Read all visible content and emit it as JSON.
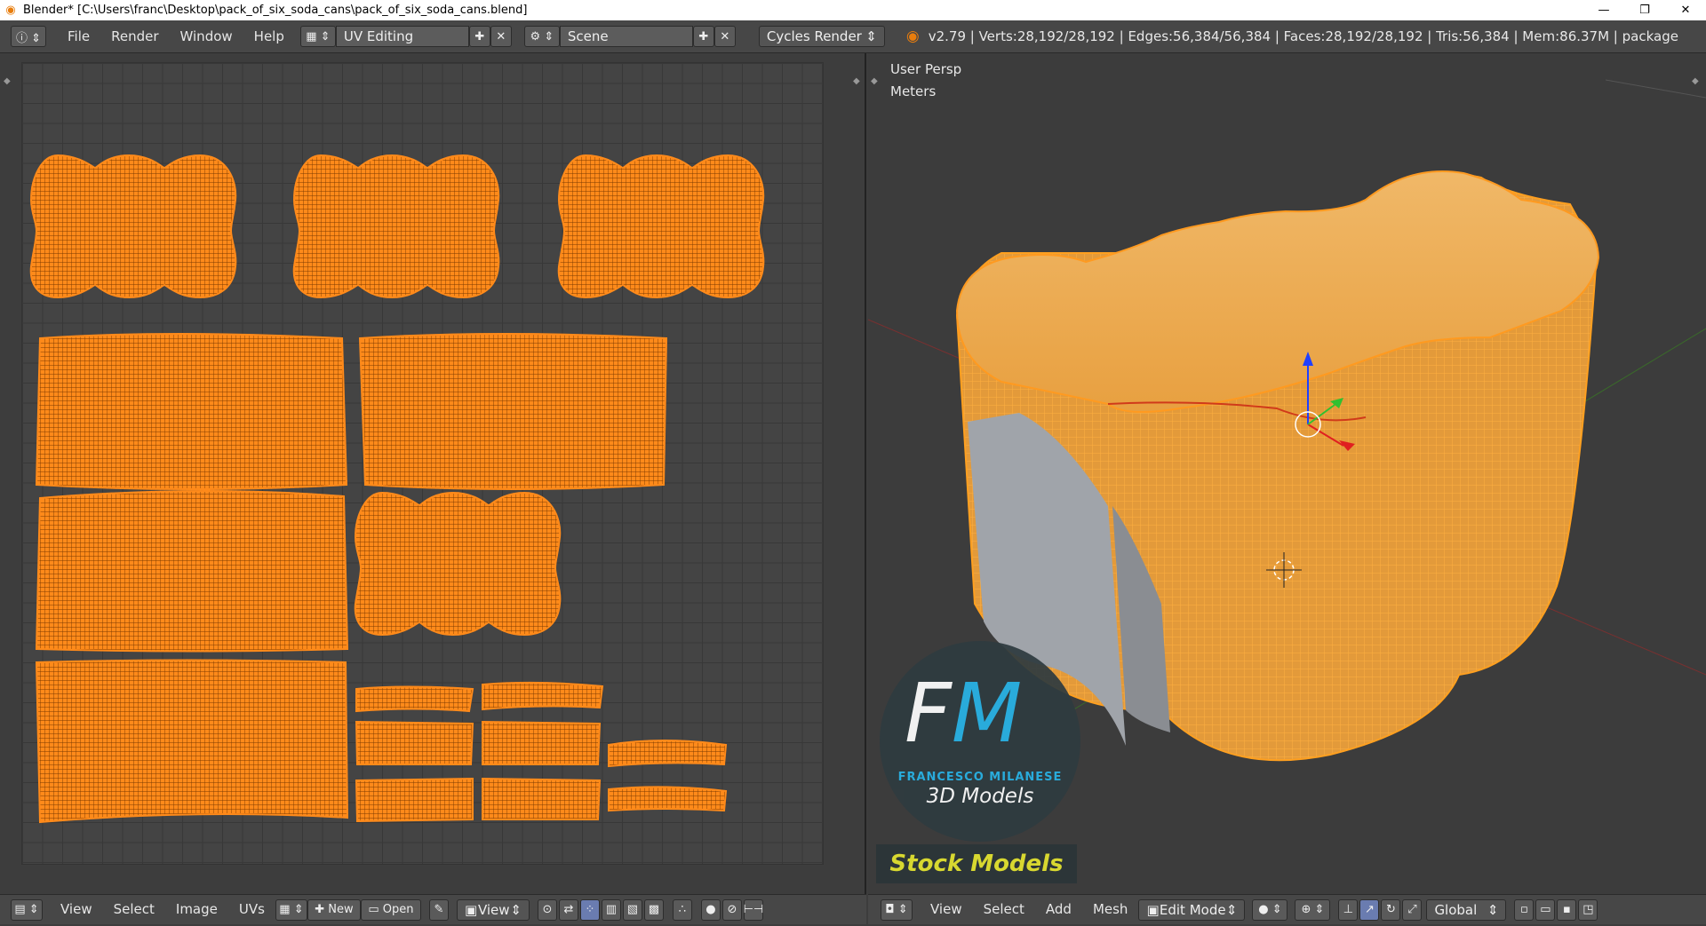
{
  "window": {
    "title": "Blender* [C:\\Users\\franc\\Desktop\\pack_of_six_soda_cans\\pack_of_six_soda_cans.blend]",
    "minimize": "—",
    "maximize": "❐",
    "close": "✕"
  },
  "topbar": {
    "menus": [
      "File",
      "Render",
      "Window",
      "Help"
    ],
    "screen_layout": "UV Editing",
    "scene": "Scene",
    "render_engine": "Cycles Render",
    "stats": "v2.79 | Verts:28,192/28,192 | Edges:56,384/56,384 | Faces:28,192/28,192 | Tris:56,384 | Mem:86.37M | package"
  },
  "viewport": {
    "view_label": "User Persp",
    "units_label": "Meters"
  },
  "watermark": {
    "logo": "FM",
    "name": "FRANCESCO MILANESE",
    "tagline": "3D Models",
    "stock": "Stock Models"
  },
  "uv_editor_bar": {
    "view": "View",
    "select": "Select",
    "image": "Image",
    "uvs": "UVs",
    "new": "New",
    "open": "Open",
    "view2": "View"
  },
  "viewport_bar": {
    "view": "View",
    "select": "Select",
    "add": "Add",
    "mesh": "Mesh",
    "mode": "Edit Mode",
    "orientation": "Global"
  },
  "colors": {
    "accent": "#f5901e",
    "uv_orange": "#ff8a1a",
    "header": "#474747"
  }
}
